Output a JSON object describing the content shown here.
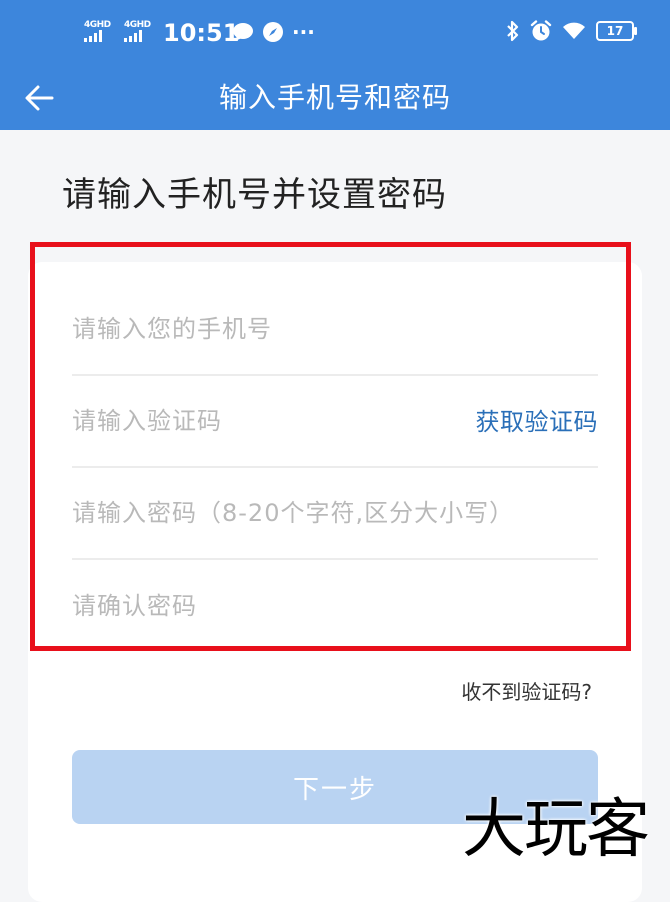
{
  "status_bar": {
    "sim1": "4GHD",
    "sim2": "4GHD",
    "time": "10:51",
    "more": "···",
    "battery": "17"
  },
  "header": {
    "title": "输入手机号和密码"
  },
  "page": {
    "heading": "请输入手机号并设置密码"
  },
  "form": {
    "phone_placeholder": "请输入您的手机号",
    "code_placeholder": "请输入验证码",
    "get_code_label": "获取验证码",
    "password_placeholder": "请输入密码（8-20个字符,区分大小写）",
    "confirm_placeholder": "请确认密码",
    "no_code_link": "收不到验证码?",
    "next_button": "下一步"
  },
  "watermark": "大玩客",
  "colors": {
    "header_blue": "#3d86dc",
    "highlight_red": "#e8101b",
    "link_blue": "#2a6fb8",
    "button_disabled": "#b9d3f2"
  },
  "icons": [
    "back-arrow-icon",
    "message-bubble-icon",
    "compass-icon",
    "bluetooth-icon",
    "alarm-icon",
    "wifi-icon",
    "battery-icon"
  ]
}
